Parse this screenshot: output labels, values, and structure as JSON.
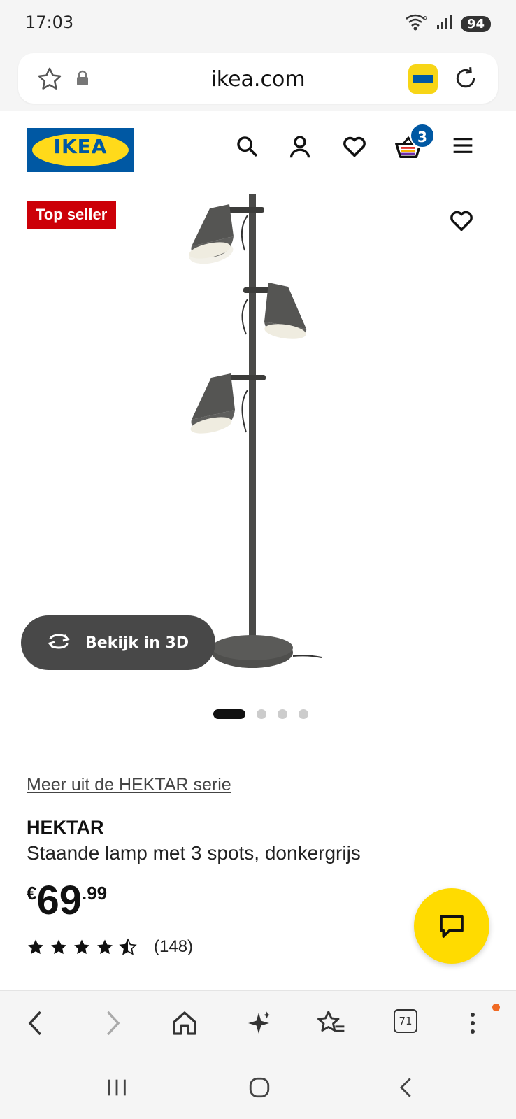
{
  "status_bar": {
    "time": "17:03",
    "battery": "94",
    "wifi_badge": "5"
  },
  "url_bar": {
    "url": "ikea.com"
  },
  "header": {
    "logo_text": "IKEA",
    "cart_count": "3"
  },
  "product_image": {
    "badge": "Top seller",
    "view_3d_label": "Bekijk in 3D",
    "carousel": {
      "total": 4,
      "active": 1
    }
  },
  "product": {
    "series_link": "Meer uit de HEKTAR serie",
    "name": "HEKTAR",
    "description": "Staande lamp met 3 spots, donkergrijs",
    "price": {
      "currency": "€",
      "integer": "69",
      "decimal": ".99"
    },
    "rating": {
      "stars": 4.5,
      "count": "(148)"
    }
  },
  "browser_toolbar": {
    "tabs_count": "71"
  },
  "colors": {
    "ikea_blue": "#0058a3",
    "ikea_yellow": "#ffda1a",
    "badge_red": "#cc0008",
    "chat_yellow": "#ffdb00"
  }
}
